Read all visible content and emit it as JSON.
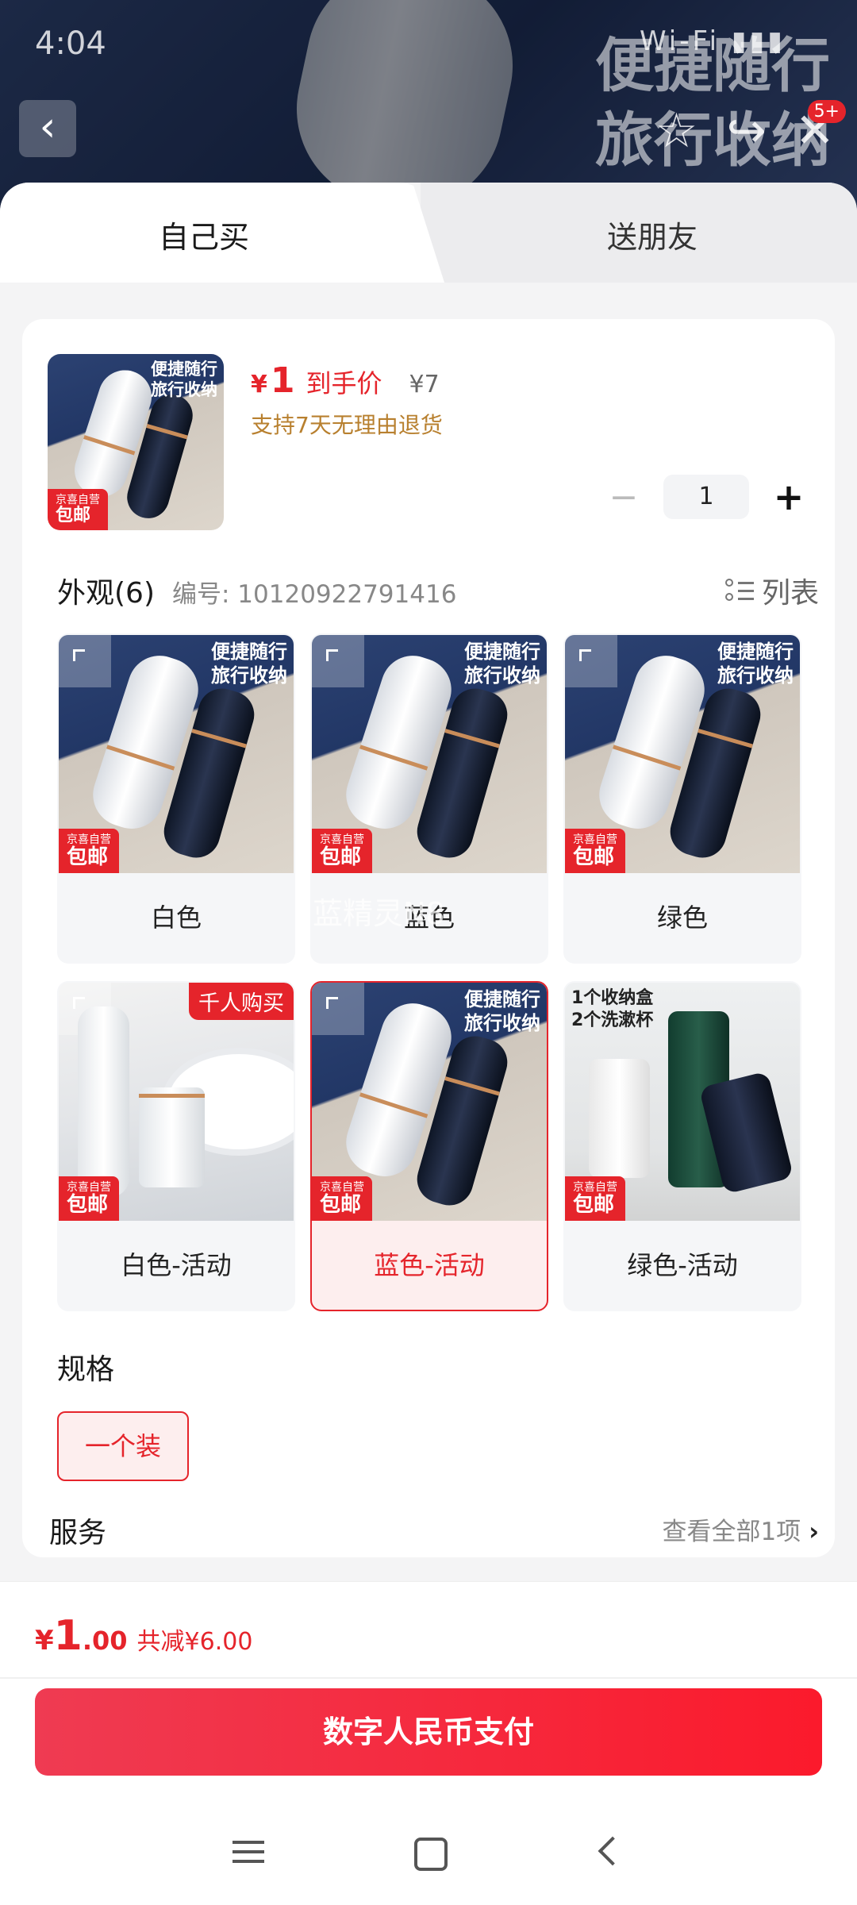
{
  "status_bar": {
    "time": "4:04",
    "icons": "Wi‑Fi ▮▮▮"
  },
  "backdrop": {
    "title": "便捷随行旅行收纳",
    "badge": "5+"
  },
  "tabs": {
    "self": "自己买",
    "friend": "送朋友"
  },
  "product": {
    "thumb_text": "便捷随行\n旅行收纳",
    "tag_small": "京喜自营",
    "tag": "包邮",
    "price_symbol": "¥",
    "price_value": "1",
    "price_label": "到手价",
    "original_price": "¥7",
    "return_note": "支持7天无理由退货",
    "quantity": "1"
  },
  "appearance": {
    "title": "外观(6)",
    "code": "编号: 10120922791416",
    "list_label": "列表",
    "options": [
      {
        "label": "白色",
        "img_text": "便捷随行\n旅行收纳",
        "tag_small": "京喜自营",
        "tag": "包邮",
        "style": "blue"
      },
      {
        "label": "蓝色",
        "img_text": "便捷随行\n旅行收纳",
        "tag_small": "京喜自营",
        "tag": "包邮",
        "style": "blue"
      },
      {
        "label": "绿色",
        "img_text": "便捷随行\n旅行收纳",
        "tag_small": "京喜自营",
        "tag": "包邮",
        "style": "blue"
      },
      {
        "label": "白色-活动",
        "hot": "千人购买",
        "tag_small": "京喜自营",
        "tag": "包邮",
        "style": "marble"
      },
      {
        "label": "蓝色-活动",
        "img_text": "便捷随行\n旅行收纳",
        "tag_small": "京喜自营",
        "tag": "包邮",
        "style": "blue",
        "selected": true
      },
      {
        "label": "绿色-活动",
        "img_text": "1个收纳盒\n2个洗漱杯",
        "tag_small": "京喜自营",
        "tag": "包邮",
        "style": "green"
      }
    ]
  },
  "spec": {
    "title": "规格",
    "option": "一个装"
  },
  "service": {
    "title": "服务",
    "more": "查看全部1项",
    "chevron": "›"
  },
  "footer": {
    "total_symbol": "¥",
    "total_int": "1",
    "total_dec": ".00",
    "discount": "共减¥6.00",
    "pay_label": "数字人民币支付"
  },
  "watermark": "蓝精灵N8",
  "colors": {
    "accent": "#e5242b",
    "gold": "#b8802f"
  }
}
